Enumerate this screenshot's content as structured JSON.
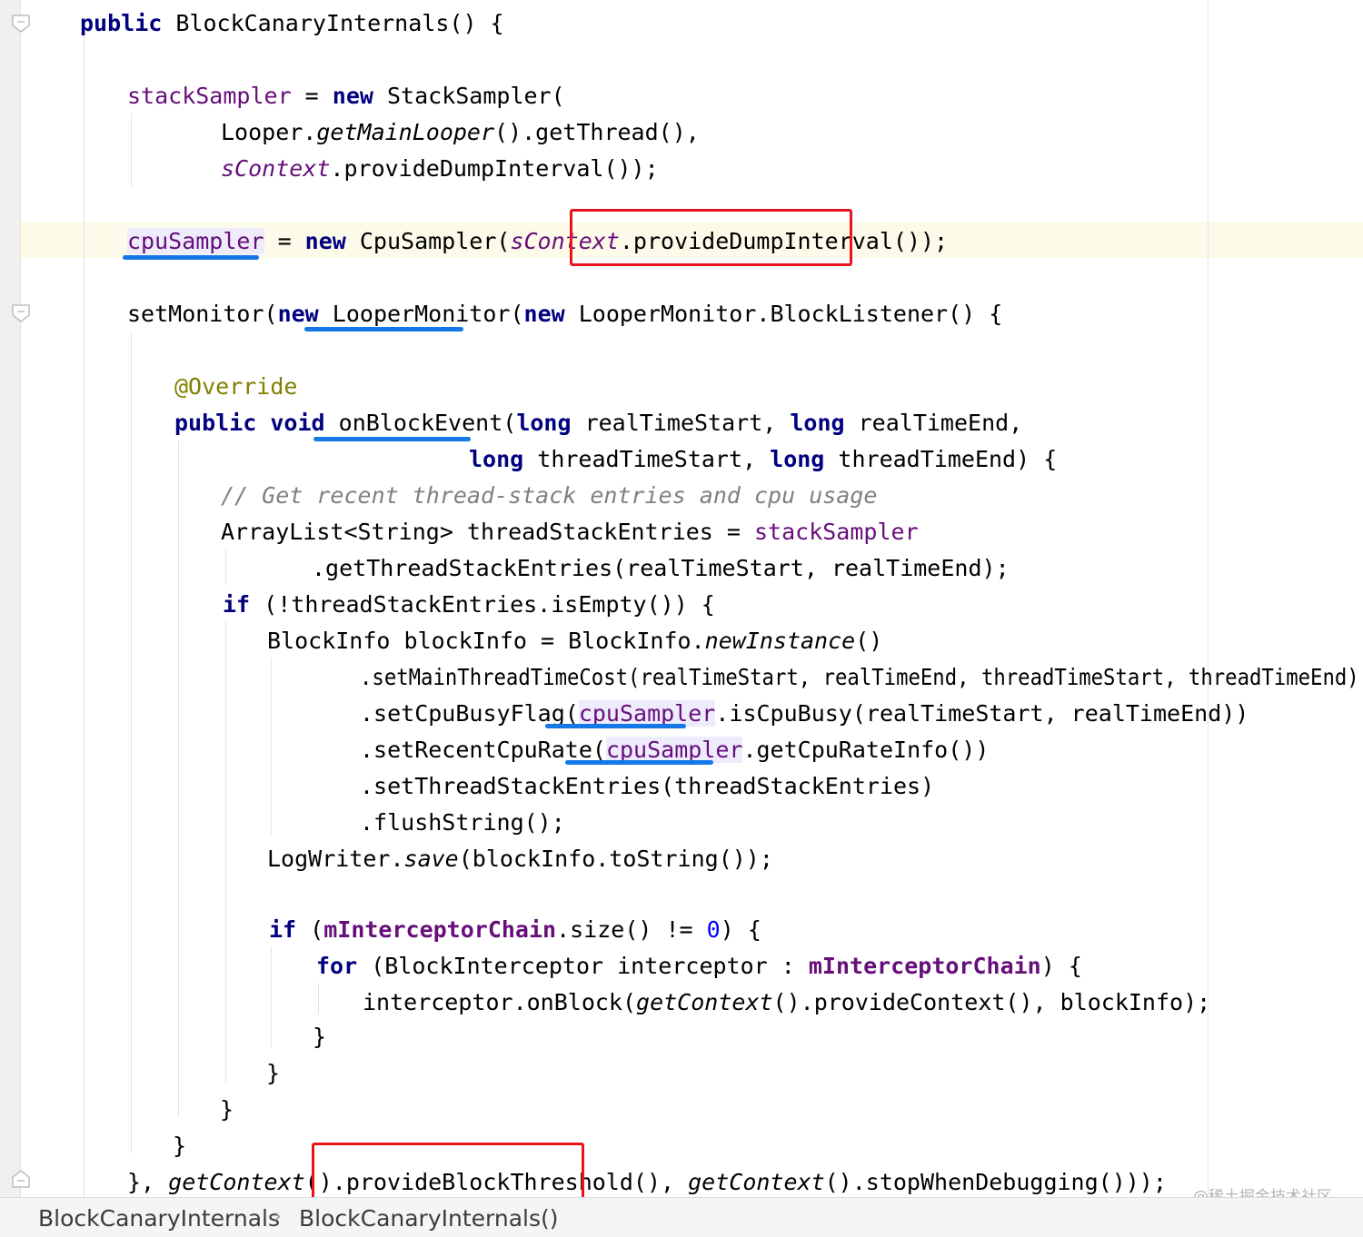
{
  "editor": {
    "lines": [
      {
        "name": "code-line-constructor",
        "tokens": [
          {
            "t": "public",
            "c": "kw"
          },
          {
            "t": " BlockCanaryInternals() {"
          }
        ]
      },
      {
        "name": "code-line-stacksampler-assign",
        "tokens": [
          {
            "t": "stackSampler",
            "c": "fld"
          },
          {
            "t": " = "
          },
          {
            "t": "new",
            "c": "kw"
          },
          {
            "t": " StackSampler("
          }
        ]
      },
      {
        "name": "code-line-looper",
        "tokens": [
          {
            "t": "Looper."
          },
          {
            "t": "getMainLooper",
            "c": "ital"
          },
          {
            "t": "().getThread(),"
          }
        ]
      },
      {
        "name": "code-line-scontext-interval",
        "tokens": [
          {
            "t": "sContext",
            "c": "sfld"
          },
          {
            "t": ".provideDumpInterval());"
          }
        ]
      },
      {
        "name": "code-line-cpusampler-assign",
        "tokens": [
          {
            "t": "cpuSampler",
            "c": "fld mark-bg"
          },
          {
            "t": " = "
          },
          {
            "t": "new",
            "c": "kw"
          },
          {
            "t": " CpuSampler("
          },
          {
            "t": "sContext",
            "c": "sfld"
          },
          {
            "t": ".provideDumpInterval());"
          }
        ]
      },
      {
        "name": "code-line-setmonitor",
        "tokens": [
          {
            "t": "setMonitor("
          },
          {
            "t": "new",
            "c": "kw"
          },
          {
            "t": " LooperMonitor("
          },
          {
            "t": "new",
            "c": "kw"
          },
          {
            "t": " LooperMonitor.BlockListener() {"
          }
        ]
      },
      {
        "name": "code-line-override",
        "tokens": [
          {
            "t": "@Override",
            "c": "ann"
          }
        ]
      },
      {
        "name": "code-line-onblockevent",
        "tokens": [
          {
            "t": "public",
            "c": "kw"
          },
          {
            "t": " "
          },
          {
            "t": "void",
            "c": "kw"
          },
          {
            "t": " onBlockEvent("
          },
          {
            "t": "long",
            "c": "kw"
          },
          {
            "t": " realTimeStart, "
          },
          {
            "t": "long",
            "c": "kw"
          },
          {
            "t": " realTimeEnd,"
          }
        ]
      },
      {
        "name": "code-line-thread-params",
        "tokens": [
          {
            "t": "long",
            "c": "kw"
          },
          {
            "t": " threadTimeStart, "
          },
          {
            "t": "long",
            "c": "kw"
          },
          {
            "t": " threadTimeEnd) {"
          }
        ]
      },
      {
        "name": "code-line-comment",
        "tokens": [
          {
            "t": "// Get recent thread-stack entries and cpu usage",
            "c": "cmt"
          }
        ]
      },
      {
        "name": "code-line-arraylist",
        "tokens": [
          {
            "t": "ArrayList<String> threadStackEntries = "
          },
          {
            "t": "stackSampler",
            "c": "fld"
          }
        ]
      },
      {
        "name": "code-line-getentries",
        "tokens": [
          {
            "t": ".getThreadStackEntries(realTimeStart, realTimeEnd);"
          }
        ]
      },
      {
        "name": "code-line-if-empty",
        "tokens": [
          {
            "t": "if",
            "c": "kw"
          },
          {
            "t": " (!threadStackEntries.isEmpty()) {"
          }
        ]
      },
      {
        "name": "code-line-blockinfo",
        "tokens": [
          {
            "t": "BlockInfo blockInfo = BlockInfo."
          },
          {
            "t": "newInstance",
            "c": "ital"
          },
          {
            "t": "()"
          }
        ]
      },
      {
        "name": "code-line-setmainthread",
        "tokens": [
          {
            "t": ".setMainThreadTimeCost(realTimeStart, realTimeEnd, threadTimeStart, threadTimeEnd)"
          }
        ]
      },
      {
        "name": "code-line-setcpubusy",
        "tokens": [
          {
            "t": ".setCpuBusyFlag("
          },
          {
            "t": "cpuSampler",
            "c": "fld mark-bg"
          },
          {
            "t": ".isCpuBusy(realTimeStart, realTimeEnd))"
          }
        ]
      },
      {
        "name": "code-line-setrecentcpu",
        "tokens": [
          {
            "t": ".setRecentCpuRate("
          },
          {
            "t": "cpuSampler",
            "c": "fld mark-bg"
          },
          {
            "t": ".getCpuRateInfo())"
          }
        ]
      },
      {
        "name": "code-line-setthreadstack",
        "tokens": [
          {
            "t": ".setThreadStackEntries(threadStackEntries)"
          }
        ]
      },
      {
        "name": "code-line-flush",
        "tokens": [
          {
            "t": ".flushString();"
          }
        ]
      },
      {
        "name": "code-line-logwriter",
        "tokens": [
          {
            "t": "LogWriter."
          },
          {
            "t": "save",
            "c": "ital"
          },
          {
            "t": "(blockInfo.toString());"
          }
        ]
      },
      {
        "name": "code-line-if-interceptor",
        "tokens": [
          {
            "t": "if",
            "c": "kw"
          },
          {
            "t": " ("
          },
          {
            "t": "mInterceptorChain",
            "c": "fld-b"
          },
          {
            "t": ".size() != "
          },
          {
            "t": "0",
            "c": "num"
          },
          {
            "t": ") {"
          }
        ]
      },
      {
        "name": "code-line-for",
        "tokens": [
          {
            "t": "for",
            "c": "kw"
          },
          {
            "t": " (BlockInterceptor interceptor : "
          },
          {
            "t": "mInterceptorChain",
            "c": "fld-b"
          },
          {
            "t": ") {"
          }
        ]
      },
      {
        "name": "code-line-onblock",
        "tokens": [
          {
            "t": "interceptor.onBlock("
          },
          {
            "t": "getContext",
            "c": "ital"
          },
          {
            "t": "().provideContext(), blockInfo);"
          }
        ]
      },
      {
        "name": "code-line-close-for",
        "tokens": [
          {
            "t": "}"
          }
        ]
      },
      {
        "name": "code-line-close-if-interceptor",
        "tokens": [
          {
            "t": "}"
          }
        ]
      },
      {
        "name": "code-line-close-if-empty",
        "tokens": [
          {
            "t": "}"
          }
        ]
      },
      {
        "name": "code-line-close-method",
        "tokens": [
          {
            "t": "}"
          }
        ]
      },
      {
        "name": "code-line-setmonitor-end",
        "tokens": [
          {
            "t": "}, "
          },
          {
            "t": "getContext",
            "c": "ital"
          },
          {
            "t": "().provideBlockThreshold(), "
          },
          {
            "t": "getContext",
            "c": "ital"
          },
          {
            "t": "().stopWhenDebugging()));"
          }
        ]
      }
    ]
  },
  "breadcrumb": {
    "items": [
      "BlockCanaryInternals",
      "BlockCanaryInternals()"
    ],
    "separator": "›"
  },
  "watermark": "@稀土掘金技术社区",
  "colors": {
    "keyword": "#000080",
    "field": "#660e7a",
    "annotation": "#808000",
    "comment": "#808080",
    "number": "#0000ff",
    "red_box": "#e8141c",
    "blue_underline": "#1478e6",
    "current_line": "#fcfae9"
  }
}
